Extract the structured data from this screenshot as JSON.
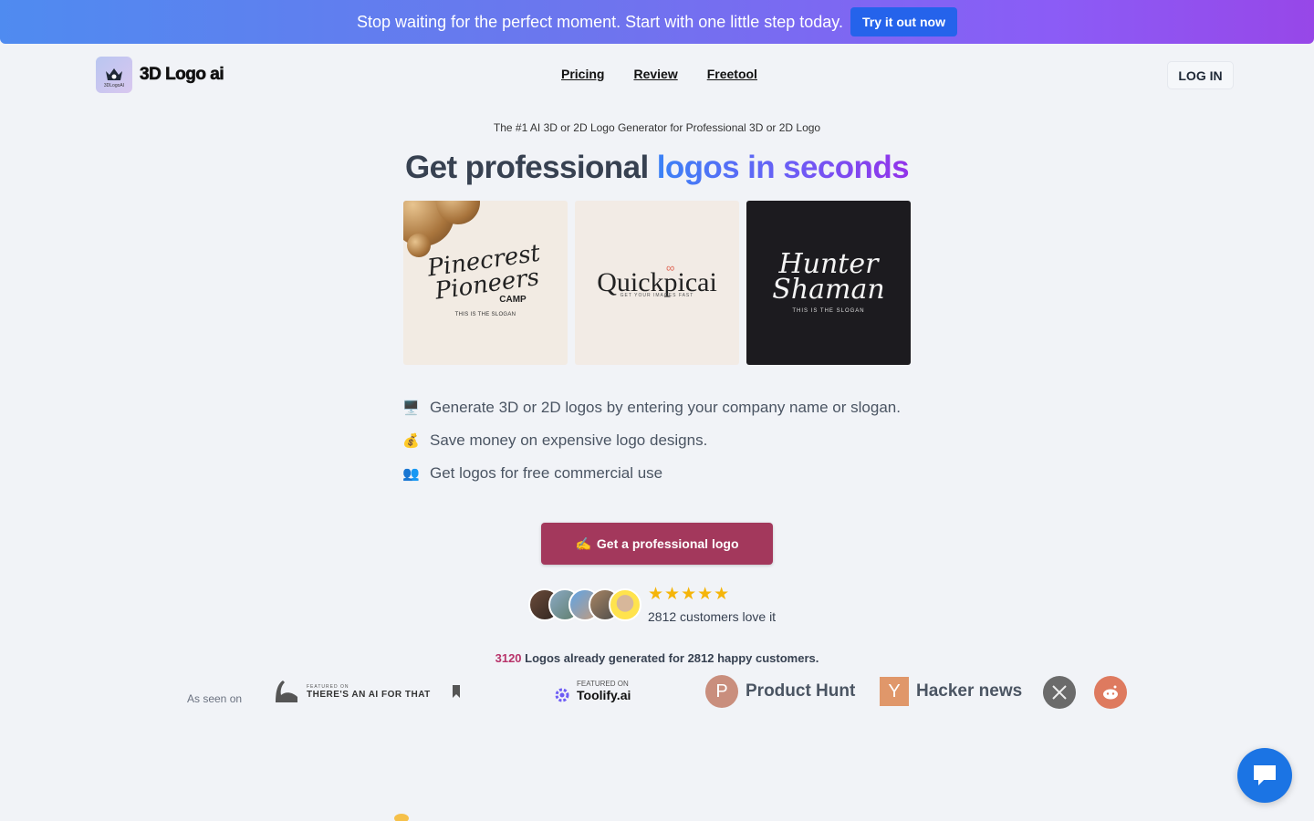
{
  "banner": {
    "text": "Stop waiting for the perfect moment. Start with one little step today.",
    "button_label": "Try it out now"
  },
  "header": {
    "logo_text": "3D Logo ai",
    "logo_mini": "3DLogoAI",
    "nav": [
      "Pricing",
      "Review",
      "Freetool"
    ],
    "login_label": "LOG IN"
  },
  "hero": {
    "tagline": "The #1 AI 3D or 2D Logo Generator for Professional 3D or 2D Logo",
    "headline_dark": "Get professional ",
    "headline_grad": "logos in seconds",
    "samples": [
      {
        "line1": "Pinecrest",
        "line2": "Pioneers",
        "extra": "CAMP",
        "slogan": "THIS IS THE SLOGAN"
      },
      {
        "name": "Quickpicai",
        "sub": "GET YOUR    IMAGES FAST"
      },
      {
        "line1": "Hunter",
        "line2": "Shaman",
        "slogan": "THIS IS THE SLOGAN"
      }
    ],
    "features": [
      {
        "icon": "🖥️",
        "text": "Generate 3D or 2D logos by entering your company name or slogan."
      },
      {
        "icon": "💰",
        "text": "Save money on expensive logo designs."
      },
      {
        "icon": "👥",
        "text": "Get logos for free commercial use"
      }
    ],
    "cta_icon": "✍️",
    "cta_label": "Get a professional logo",
    "stars": "★★★★★",
    "rating": 5,
    "customers_text": "2812 customers love it",
    "generated_count": "3120",
    "generated_text": " Logos already generated for 2812 happy customers."
  },
  "press": {
    "seen_on": "As seen on",
    "taaft_small": "FEATURED ON",
    "taaft_name": "THERE'S AN AI FOR THAT",
    "toolify_featured": "FEATURED ON",
    "toolify_name": "Toolify.ai",
    "ph_letter": "P",
    "ph_name": "Product Hunt",
    "hn_letter": "Y",
    "hn_name": "Hacker news"
  },
  "colors": {
    "cta": "#a3385c",
    "accent_blue": "#2563eb",
    "stars": "#f5b50a",
    "count": "#b8336a"
  }
}
